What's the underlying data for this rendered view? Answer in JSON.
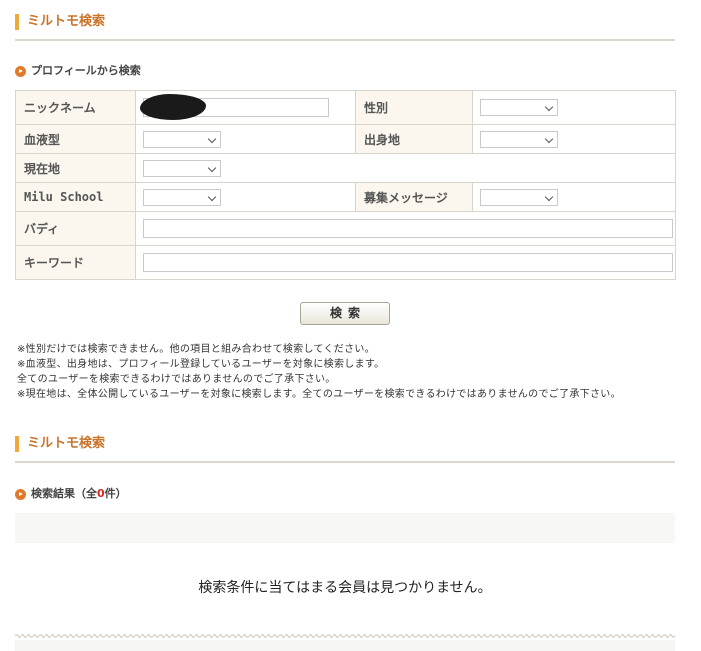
{
  "section1": {
    "title": "ミルトモ検索"
  },
  "profile_search": {
    "heading": "プロフィールから検索"
  },
  "form": {
    "nickname_label": "ニックネーム",
    "gender_label": "性別",
    "blood_label": "血液型",
    "birthplace_label": "出身地",
    "location_label": "現在地",
    "school_label": "Milu School",
    "recruit_label": "募集メッセージ",
    "buddy_label": "バディ",
    "keyword_label": "キーワード"
  },
  "search_button": {
    "label": "検索"
  },
  "notes": [
    "※性別だけでは検索できません。他の項目と組み合わせて検索してください。",
    "※血液型、出身地は、プロフィール登録しているユーザーを対象に検索します。",
    "全てのユーザーを検索できるわけではありませんのでご了承下さい。",
    "※現在地は、全体公開しているユーザーを対象に検索します。全てのユーザーを検索できるわけではありませんのでご了承下さい。"
  ],
  "section2": {
    "title": "ミルトモ検索"
  },
  "results": {
    "heading_prefix": "検索結果（全",
    "count": "0",
    "heading_suffix": "件）",
    "empty_message": "検索条件に当てはまる会員は見つかりません。"
  },
  "colors": {
    "accent_orange": "#f0a93b",
    "title_text": "#c8742a",
    "label_bg": "#fbf7ef",
    "count_red": "#d6281b"
  }
}
